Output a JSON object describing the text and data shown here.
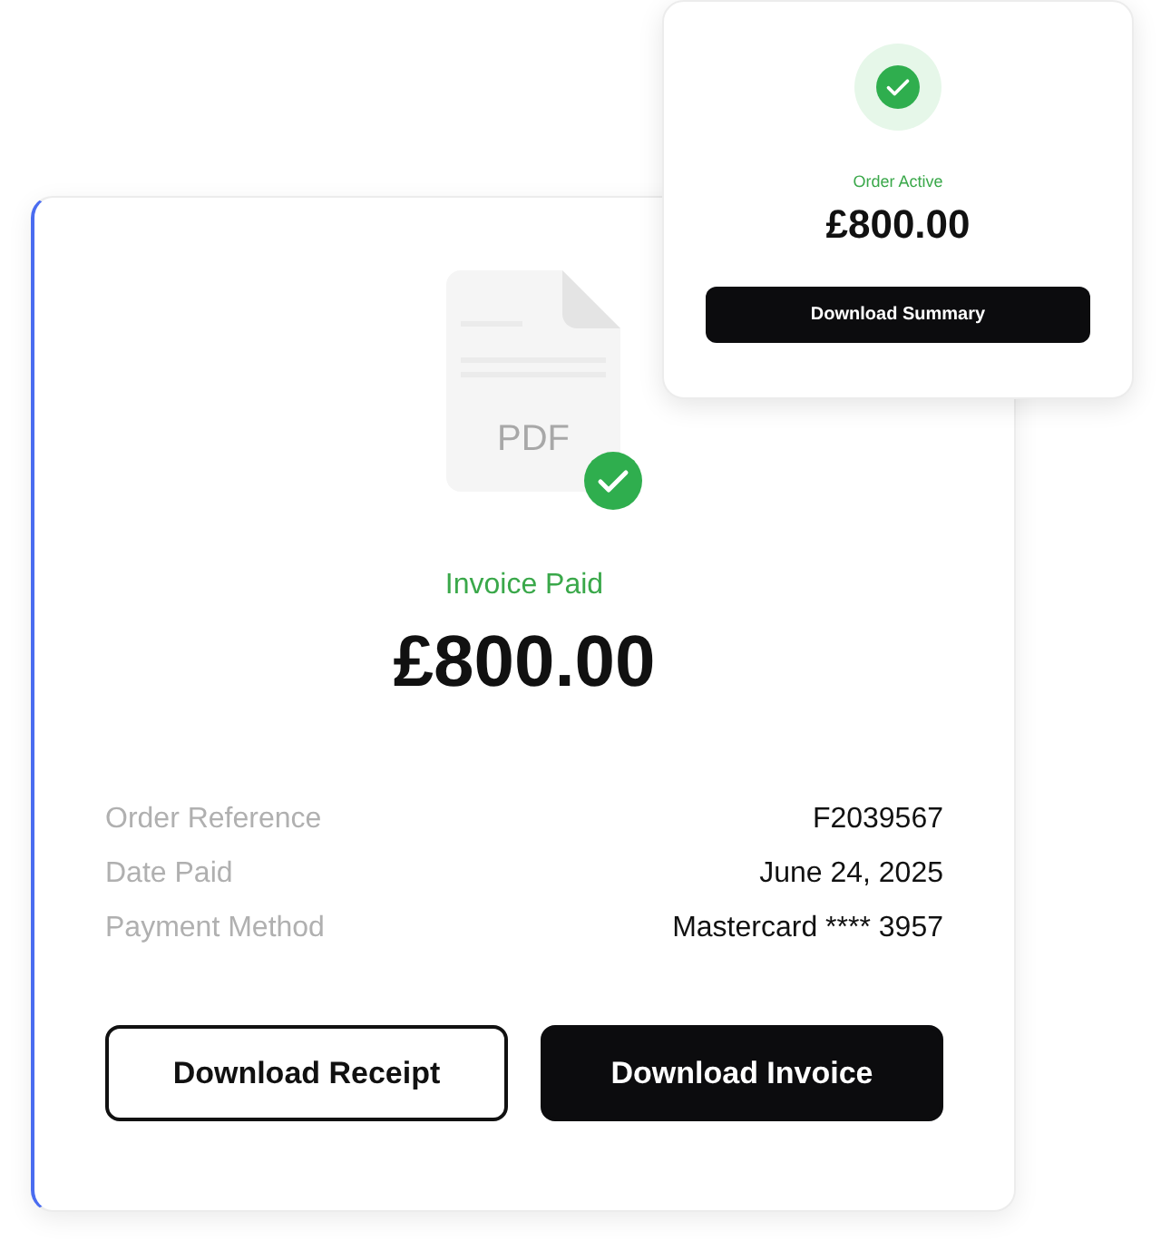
{
  "invoice_card": {
    "file_icon_label": "PDF",
    "status": "Invoice Paid",
    "amount": "£800.00",
    "details": [
      {
        "label": "Order Reference",
        "value": "F2039567"
      },
      {
        "label": "Date Paid",
        "value": "June 24, 2025"
      },
      {
        "label": "Payment Method",
        "value": "Mastercard **** 3957"
      }
    ],
    "buttons": [
      {
        "label": "Download Receipt",
        "kind": "outline"
      },
      {
        "label": "Download Invoice",
        "kind": "solid"
      }
    ]
  },
  "summary_card": {
    "status": "Order Active",
    "amount": "£800.00",
    "button": "Download Summary"
  }
}
